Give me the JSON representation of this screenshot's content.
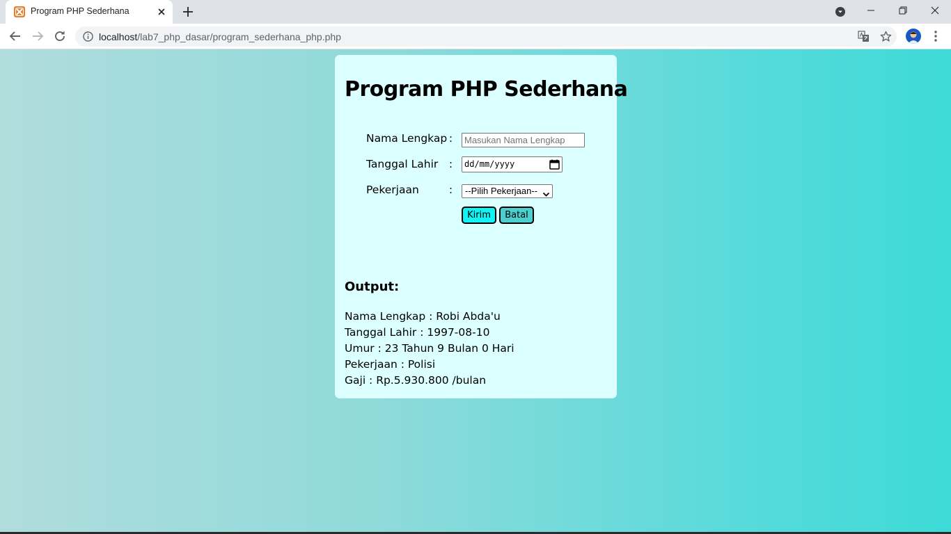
{
  "browser": {
    "tab_title": "Program PHP Sederhana",
    "url_host": "localhost",
    "url_path": "/lab7_php_dasar/program_sederhana_php.php"
  },
  "page": {
    "title": "Program PHP Sederhana",
    "form": {
      "nama_label": "Nama Lengkap",
      "nama_placeholder": "Masukan Nama Lengkap",
      "tanggal_label": "Tanggal Lahir",
      "tanggal_value": "dd/mm/yyyy",
      "pekerjaan_label": "Pekerjaan",
      "pekerjaan_selected": "--Pilih Pekerjaan--",
      "separator": ":",
      "submit_label": "Kirim",
      "cancel_label": "Batal"
    },
    "output": {
      "heading": "Output:",
      "lines": [
        "Nama Lengkap : Robi Abda'u",
        "Tanggal Lahir : 1997-08-10",
        "Umur : 23 Tahun 9 Bulan 0 Hari",
        "Pekerjaan : Polisi",
        "Gaji : Rp.5.930.800 /bulan"
      ]
    }
  },
  "colors": {
    "card_bg": "#dcffff",
    "submit_bg": "#12f4f4",
    "cancel_bg": "#4ccfcf",
    "gradient_left": "#b1dcdc",
    "gradient_right": "#3ddad7"
  }
}
